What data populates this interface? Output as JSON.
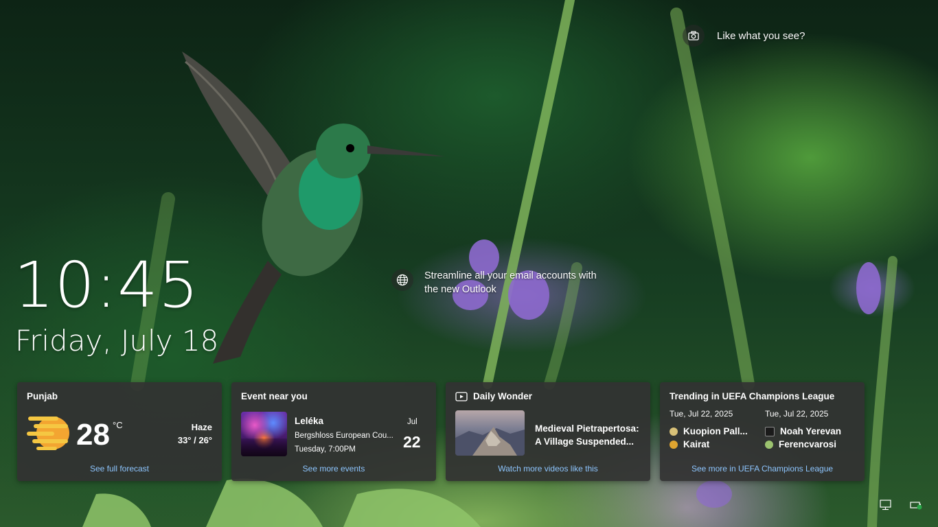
{
  "spotlight": {
    "text": "Like what you see?",
    "icon": "camera-icon"
  },
  "promo": {
    "text": "Streamline all your email accounts with the new Outlook",
    "icon": "globe-icon"
  },
  "lockscreen": {
    "time": "10:45",
    "date": "Friday, July 18"
  },
  "weather": {
    "location": "Punjab",
    "temperature": "28",
    "unit": "°C",
    "condition": "Haze",
    "range": "33° / 26°",
    "link": "See full forecast",
    "icon": "haze-sun-icon"
  },
  "event": {
    "title": "Event near you",
    "name": "Leléka",
    "venue": "Bergshloss European Cou...",
    "time": "Tuesday, 7:00PM",
    "month": "Jul",
    "day": "22",
    "link": "See more events"
  },
  "wonder": {
    "title": "Daily Wonder",
    "headline_line1": "Medieval Pietrapertosa:",
    "headline_line2": "A Village Suspended...",
    "link": "Watch more videos like this",
    "icon": "video-icon"
  },
  "trending": {
    "title": "Trending in UEFA Champions League",
    "matches": [
      {
        "date": "Tue, Jul 22, 2025",
        "team1": "Kuopion Pall...",
        "team2": "Kairat"
      },
      {
        "date": "Tue, Jul 22, 2025",
        "team1": "Noah Yerevan",
        "team2": "Ferencvarosi"
      }
    ],
    "link": "See more in UEFA Champions League"
  },
  "tray": {
    "network_icon": "network-icon",
    "battery_icon": "battery-icon"
  },
  "colors": {
    "card_bg": "#323232",
    "link": "#8ec6ff",
    "text": "#ffffff"
  }
}
